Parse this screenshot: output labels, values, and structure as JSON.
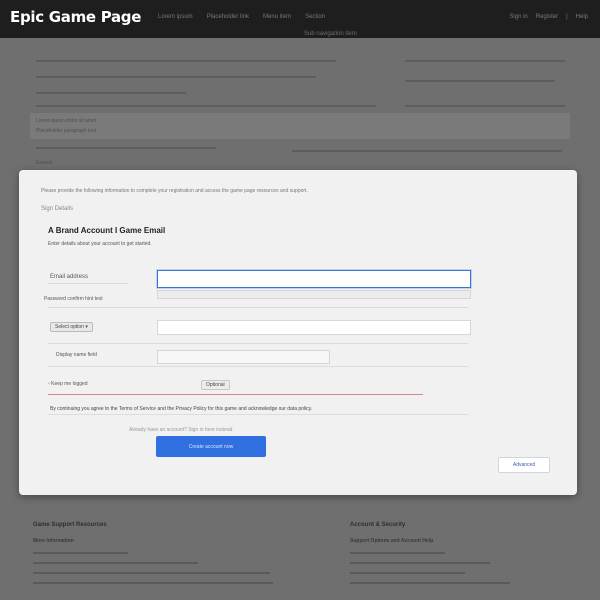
{
  "header": {
    "logo": "Epic Game Page",
    "logo_icon": "controller-icon",
    "nav": [
      "Lorem ipsum",
      "Placeholder link",
      "Menu item",
      "Section"
    ],
    "sub_nav": "Sub navigation item",
    "right_links": [
      "Sign in",
      "Register",
      "|",
      "Help"
    ]
  },
  "background": {
    "lines": [
      "Lorem ipsum dolor sit amet",
      "Placeholder paragraph text",
      "Another line of text",
      "More content here"
    ],
    "label": "Eraved"
  },
  "modal": {
    "note": "Please provide the following information to complete your registration and access the game page resources and support.",
    "section": "Sign Details",
    "title": "A Brand Account I Game Email",
    "description": "Enter details about your account to get started.",
    "fields": [
      {
        "label": "Email address",
        "value": "",
        "placeholder": ""
      },
      {
        "label": "Password confirm hint text",
        "value": "",
        "placeholder": ""
      },
      {
        "label": "Select option",
        "value": "",
        "placeholder": ""
      },
      {
        "label": "Display name field",
        "value": "",
        "placeholder": ""
      }
    ],
    "checkbox_label": "Keep me logged",
    "checkbox_chip": "Optional",
    "terms": "By continuing you agree to the Terms of Service and the Privacy Policy for this game and acknowledge our data policy.",
    "hint": "Already have an account? Sign in here instead",
    "primary_button": "Create account now",
    "secondary_button": "Advanced"
  },
  "footer": {
    "col1": {
      "heading": "Game Support Resources",
      "sub": "More Information"
    },
    "col2": {
      "heading": "Account & Security",
      "sub": "Support Options and Account Help"
    }
  },
  "colors": {
    "primary": "#2f6fe0",
    "focus": "#3a74d6",
    "topbar": "#1e1e1e",
    "overlay": "#6f6f6f"
  }
}
